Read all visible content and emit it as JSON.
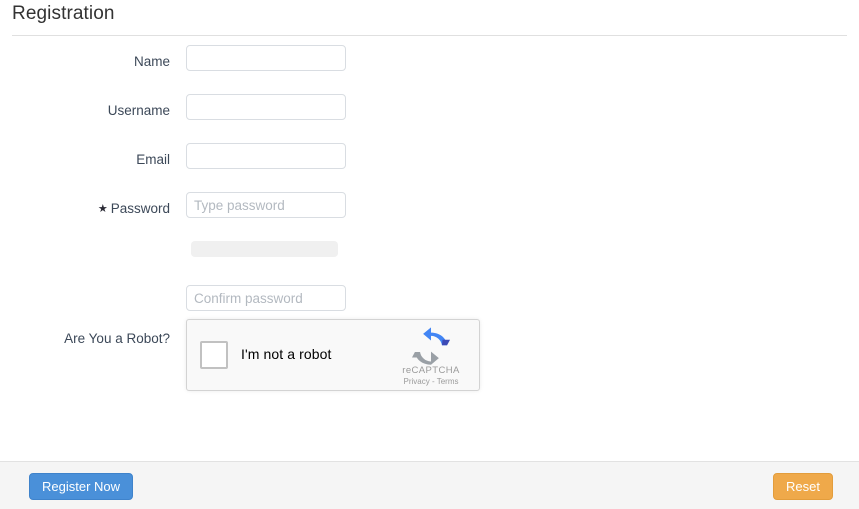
{
  "header": {
    "title": "Registration"
  },
  "form": {
    "fields": [
      {
        "label": "Name",
        "value": "",
        "placeholder": "",
        "type": "text",
        "required": false
      },
      {
        "label": "Username",
        "value": "",
        "placeholder": "",
        "type": "text",
        "required": false
      },
      {
        "label": "Email",
        "value": "",
        "placeholder": "",
        "type": "text",
        "required": false
      },
      {
        "label": "Password",
        "value": "",
        "placeholder": "Type password",
        "type": "password",
        "required": true
      }
    ],
    "required_marker": "★",
    "password_strength": {
      "value": 0,
      "track_color": "#f0f0f0",
      "fill_color": "#5cb85c"
    },
    "confirm_password": {
      "label": "",
      "value": "",
      "placeholder": "Confirm password"
    },
    "captcha": {
      "label": "Are You a Robot?",
      "checkbox_label": "I'm not a robot",
      "checked": false,
      "brand_name": "reCAPTCHA",
      "legal": "Privacy - Terms",
      "logo_blue": "#4285f4",
      "logo_dark_blue": "#3c4ab5",
      "logo_grey": "#9aa0a6"
    }
  },
  "footer": {
    "submit_label": "Register Now",
    "reset_label": "Reset",
    "submit_color": "#4a90d9",
    "reset_color": "#efa94a"
  }
}
